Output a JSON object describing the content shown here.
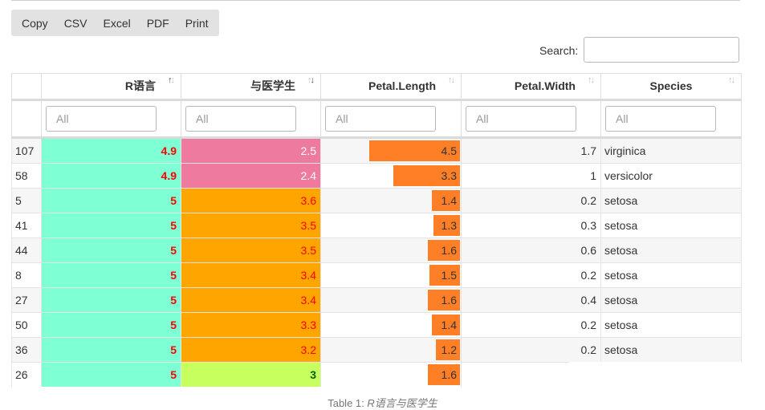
{
  "toolbar": {
    "buttons": [
      "Copy",
      "CSV",
      "Excel",
      "PDF",
      "Print"
    ]
  },
  "search": {
    "label": "Search:",
    "value": "",
    "placeholder": ""
  },
  "columns": [
    {
      "label": "",
      "sort": "none"
    },
    {
      "label": "R语言",
      "sort": "asc"
    },
    {
      "label": "与医学生",
      "sort": "desc"
    },
    {
      "label": "Petal.Length",
      "sort": "none"
    },
    {
      "label": "Petal.Width",
      "sort": "none"
    },
    {
      "label": "Species",
      "sort": "none"
    }
  ],
  "filter_placeholder": "All",
  "colors": {
    "sepal_bg": "#7fffd4",
    "petal_length_bar": "#ff7f27",
    "width_bg_high": "#ee7aa0",
    "width_bg_mid": "#ffa500",
    "width_bg_low": "#c7ff5e",
    "text_red": "#ff0000",
    "text_green": "#006400"
  },
  "petal_length_max": 6.9,
  "rows": [
    {
      "id": "107",
      "sepal": "4.9",
      "width": "2.5",
      "petal_length": "4.5",
      "petal_width": "1.7",
      "species": "virginica"
    },
    {
      "id": "58",
      "sepal": "4.9",
      "width": "2.4",
      "petal_length": "3.3",
      "petal_width": "1",
      "species": "versicolor"
    },
    {
      "id": "5",
      "sepal": "5",
      "width": "3.6",
      "petal_length": "1.4",
      "petal_width": "0.2",
      "species": "setosa"
    },
    {
      "id": "41",
      "sepal": "5",
      "width": "3.5",
      "petal_length": "1.3",
      "petal_width": "0.3",
      "species": "setosa"
    },
    {
      "id": "44",
      "sepal": "5",
      "width": "3.5",
      "petal_length": "1.6",
      "petal_width": "0.6",
      "species": "setosa"
    },
    {
      "id": "8",
      "sepal": "5",
      "width": "3.4",
      "petal_length": "1.5",
      "petal_width": "0.2",
      "species": "setosa"
    },
    {
      "id": "27",
      "sepal": "5",
      "width": "3.4",
      "petal_length": "1.6",
      "petal_width": "0.4",
      "species": "setosa"
    },
    {
      "id": "50",
      "sepal": "5",
      "width": "3.3",
      "petal_length": "1.4",
      "petal_width": "0.2",
      "species": "setosa"
    },
    {
      "id": "36",
      "sepal": "5",
      "width": "3.2",
      "petal_length": "1.2",
      "petal_width": "0.2",
      "species": "setosa"
    },
    {
      "id": "26",
      "sepal": "5",
      "width": "3",
      "petal_length": "1.6",
      "petal_width": "",
      "species": ""
    }
  ],
  "caption": {
    "prefix": "Table 1: ",
    "title": "R语言与医学生"
  }
}
